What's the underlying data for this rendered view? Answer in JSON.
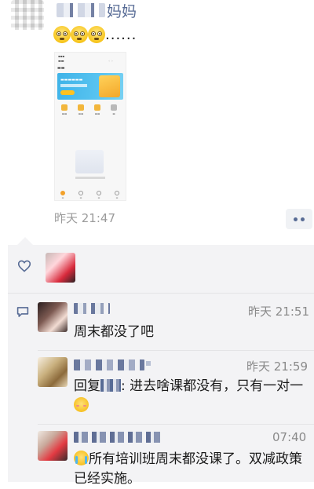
{
  "post": {
    "author_name_visible": "妈妈",
    "text_trailing": "......",
    "emoji_count": 3,
    "emoji_icon": "flushed-face-icon",
    "time": "昨天 21:47",
    "more_icon": "more-dots-icon",
    "link_color": "#576b95"
  },
  "likes": {
    "icon": "heart-icon",
    "count_visible": 1
  },
  "comments": [
    {
      "time": "昨天 21:51",
      "text": "周末都没了吧"
    },
    {
      "time": "昨天 21:59",
      "reply_prefix": "回复",
      "text_after": ": 进去啥课都没有，只有一对一",
      "emoji_icon": "blush-face-icon"
    },
    {
      "time": "07:40",
      "emoji_icon": "sob-face-icon",
      "text": "所有培训班周末都没课了。双减政策已经实施。"
    }
  ],
  "comment_icon": "comment-bubble-icon"
}
